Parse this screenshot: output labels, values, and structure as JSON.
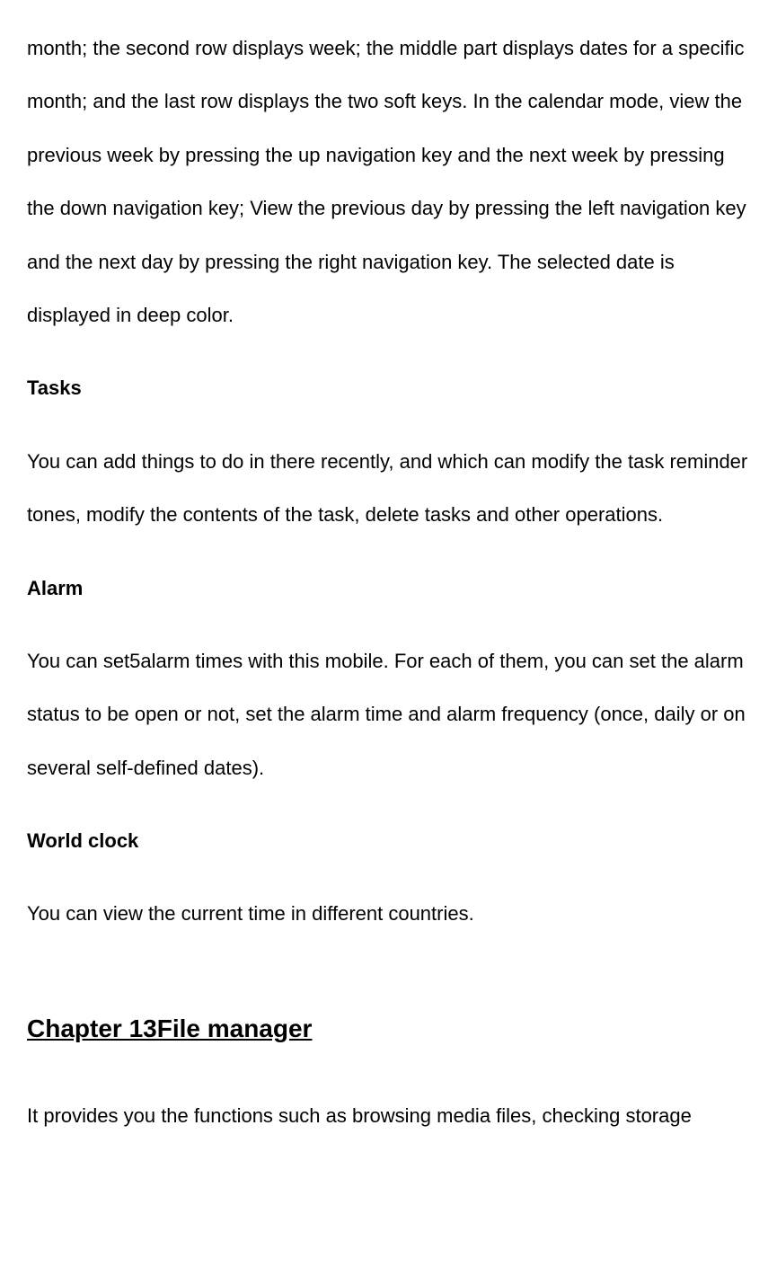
{
  "paragraph1": "month; the second row displays week; the middle part displays dates for a specific month; and the last row displays the two soft keys. In the calendar mode, view the previous week by pressing the up navigation key and the next week by pressing the down navigation key; View the previous day by pressing the left navigation key and the next day by pressing the right navigation key. The selected date is displayed in deep color.",
  "heading_tasks": "Tasks",
  "paragraph_tasks": "You can add things to do in there recently, and which can modify the task reminder tones, modify the contents of the task, delete tasks and other operations.",
  "heading_alarm": "Alarm",
  "paragraph_alarm": "You can set5alarm times with this mobile. For each of them, you can set the alarm status to be open or not, set the alarm time and alarm frequency (once, daily or on several self-defined dates).",
  "heading_world_clock": "World clock",
  "paragraph_world_clock": "You can view the current time in different countries.",
  "chapter_heading": "Chapter 13File manager",
  "paragraph_file_manager": "It provides you the functions such as browsing media files, checking storage"
}
